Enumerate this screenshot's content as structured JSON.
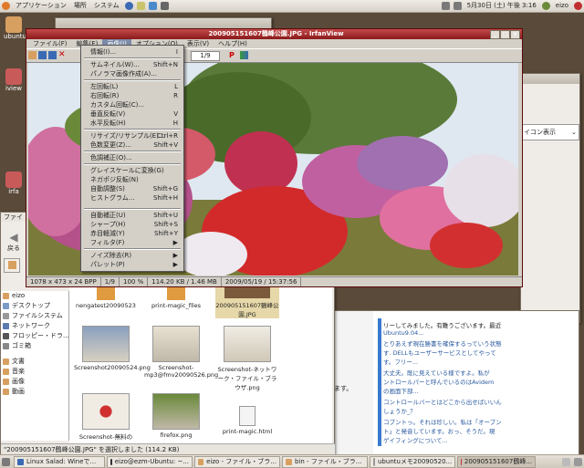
{
  "top_panel": {
    "menus": [
      "アプリケーション",
      "場所",
      "システム"
    ],
    "datetime": "5月30日 (土) 午後 3:16",
    "user": "eizo"
  },
  "desktop": {
    "icons": [
      "ubuntu",
      "iview",
      "irfa"
    ]
  },
  "irfanview": {
    "title": "200905151607鶴峰公園.JPG - IrfanView",
    "menus": [
      "ファイル(F)",
      "編集(E)",
      "画像(I)",
      "オプション(O)",
      "表示(V)",
      "ヘルプ(H)"
    ],
    "page_field": "1/9",
    "status": [
      "1078 x 473 x 24 BPP",
      "1/9",
      "100 %",
      "114.20 KB / 1.46 MB",
      "2009/05/19 / 15:37:56"
    ]
  },
  "image_menu": {
    "items": [
      {
        "label": "情報(I)...",
        "shortcut": "I"
      },
      {
        "label": "サムネイル(W)...",
        "shortcut": "Shift+N"
      },
      {
        "label": "パノラマ画像作成(A)...",
        "shortcut": ""
      },
      {
        "label": "左回転(L)",
        "shortcut": "L"
      },
      {
        "label": "右回転(R)",
        "shortcut": "R"
      },
      {
        "label": "カスタム回転(C)...",
        "shortcut": ""
      },
      {
        "label": "垂直反転(V)",
        "shortcut": "V"
      },
      {
        "label": "水平反転(H)",
        "shortcut": "H"
      },
      {
        "label": "リサイズ/リサンプル(E)...",
        "shortcut": "Ctrl+R"
      },
      {
        "label": "色数変更(Z)...",
        "shortcut": "Shift+V"
      },
      {
        "label": "色調補正(O)...",
        "shortcut": ""
      },
      {
        "label": "グレイスケールに変換(G)",
        "shortcut": ""
      },
      {
        "label": "ネガポジ反転(N)",
        "shortcut": ""
      },
      {
        "label": "自動調整(S)",
        "shortcut": "Shift+G"
      },
      {
        "label": "ヒストグラム...",
        "shortcut": "Shift+H"
      },
      {
        "label": "自動補正(U)",
        "shortcut": "Shift+U"
      },
      {
        "label": "シャープ(H)",
        "shortcut": "Shift+S"
      },
      {
        "label": "赤目軽減(Y)",
        "shortcut": "Shift+Y"
      },
      {
        "label": "フィルタ(F)",
        "shortcut": "▶"
      },
      {
        "label": "ノイズ除去(R)",
        "shortcut": "▶"
      },
      {
        "label": "パレット(P)",
        "shortcut": "▶"
      }
    ]
  },
  "file_manager": {
    "title": "ファイ",
    "back_label": "戻る",
    "sidebar": [
      "eizo",
      "デスクトップ",
      "ファイルシステム",
      "ネットワーク",
      "フロッピー・ドラ...",
      "ゴミ箱",
      "文書",
      "音楽",
      "画像",
      "動画"
    ],
    "files": [
      {
        "name": "nengatest20090523"
      },
      {
        "name": "print-magic_files"
      },
      {
        "name": "200905151607鶴峰公園.JPG"
      },
      {
        "name": "Screenshot20090524.png"
      },
      {
        "name": "Screenshot-mp3@fmv20090526.png"
      },
      {
        "name": "Screenshot-ネットワーク・ファイル・ブラウザ.png"
      },
      {
        "name": "Screenshot-無料のオ..."
      },
      {
        "name": "firefox.png"
      },
      {
        "name": "print-magic.html"
      }
    ],
    "status": "\"200905151607鶴峰公園.JPG\" を選択しました (114.2 KB)"
  },
  "blog": {
    "lines": [
      "リーしてみました。有難うございます。最近",
      "Ubuntu9.04...",
      "とりあえず現在勝書を確保するっていう状態",
      "す. DELLもユーザーサービスとしてやって",
      "す。フリー...",
      "大丈夫。既に見えている様ですよ。私が",
      "ントロールパーと呼んでいるのはAvidem",
      "の画面下部...",
      "コントロールバーとはどこから出せばいいん",
      "しょうか_？",
      "コブントっ。それは珍しい。私は「オープン",
      "ト」と発音しています。おっ、そうだ。現",
      "ゲイフィングについて..."
    ],
    "left_snip": "ます。"
  },
  "right_window": {
    "label": "イコン表示"
  },
  "taskbar": {
    "items": [
      "Linux Salad: Wineで...",
      "eizo@ezm-Ubuntu: ~...",
      "eizo - ファイル・ブラ...",
      "bin - ファイル・ブラ...",
      "ubuntuメモ20090520...",
      "200905151607鶴峰..."
    ]
  },
  "colors": {
    "accent": "#8a1a1a",
    "panel": "#ddd7ce"
  }
}
